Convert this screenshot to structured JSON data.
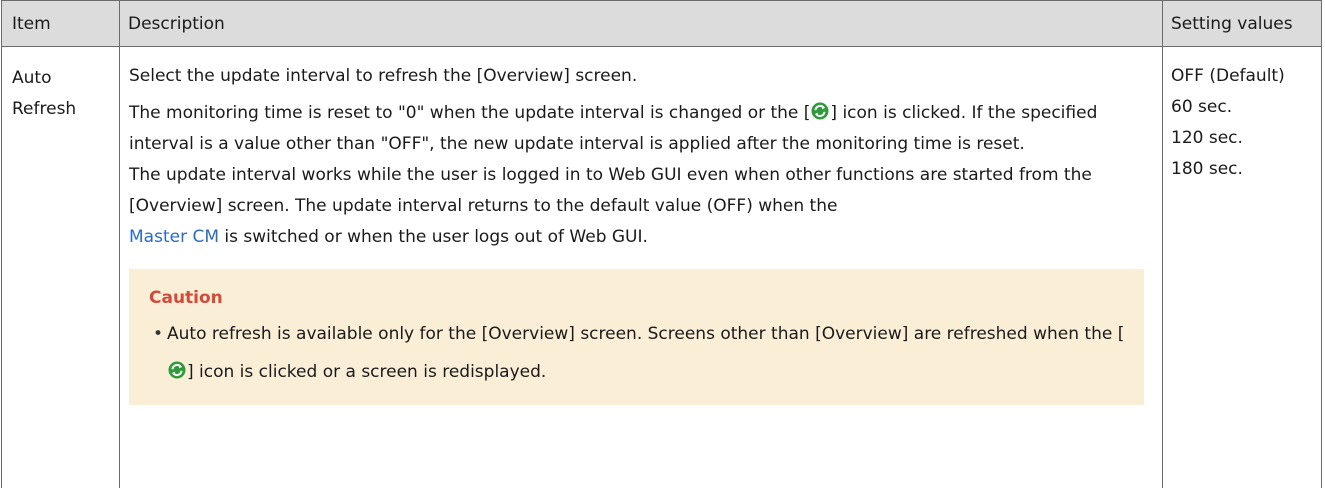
{
  "headers": {
    "item": "Item",
    "description": "Description",
    "setting_values": "Setting values"
  },
  "row": {
    "item_name": "Auto\nRefresh",
    "p1": "Select the update interval to refresh the [Overview] screen.",
    "p2_a": "The monitoring time is reset to \"0\" when the update interval is changed or the [",
    "p2_b": "] icon is clicked. If the specified interval is a value other than \"OFF\", the new update interval is applied after the monitoring time is reset.",
    "p3": "The update interval works while the user is logged in to Web GUI even when other functions are started from the [Overview] screen. The update interval returns to the default value (OFF) when the",
    "p4_link": "Master CM",
    "p4_rest": " is switched or when the user logs out of Web GUI.",
    "caution_title": "Caution",
    "caution_a": "Auto refresh is available only for the [Overview] screen. Screens other than [Overview] are refreshed when the [",
    "caution_b": "] icon is clicked or a screen is redisplayed.",
    "values": [
      "OFF (Default)",
      "60 sec.",
      "120 sec.",
      "180 sec."
    ]
  },
  "icons": {
    "refresh": "refresh-icon"
  },
  "colors": {
    "header_bg": "#dcdcdc",
    "border": "#6b6b6b",
    "link": "#2a6ac8",
    "caution_bg": "#fbeed7",
    "caution_title": "#d24a3a",
    "icon_green": "#2e9a3a"
  }
}
